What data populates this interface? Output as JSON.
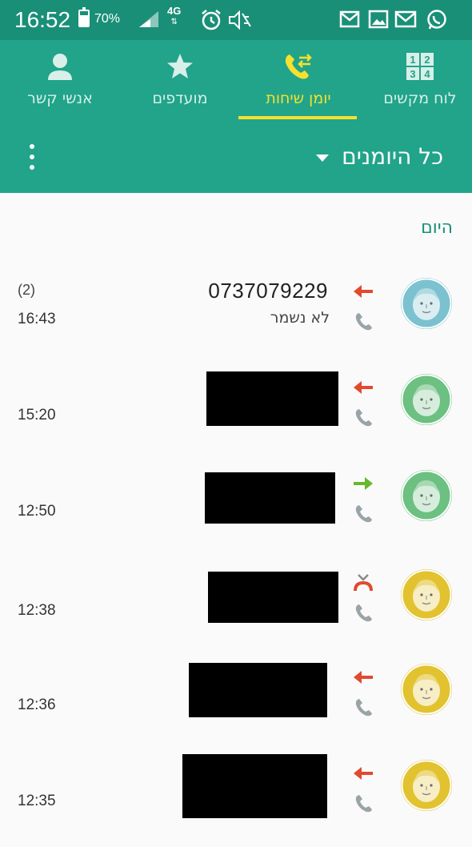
{
  "status_bar": {
    "time": "16:52",
    "battery_percent": "70%",
    "battery_level": 0.7,
    "network": "4G",
    "icons": [
      "battery-icon",
      "signal-icon",
      "alarm-icon",
      "mute-icon",
      "gmail-icon",
      "gallery-icon",
      "gmail-icon",
      "whatsapp-icon"
    ]
  },
  "tabs": [
    {
      "label": "לוח מקשים",
      "icon": "dialpad-icon"
    },
    {
      "label": "יומן שיחות",
      "icon": "call-log-icon",
      "active": true
    },
    {
      "label": "מועדפים",
      "icon": "star-icon"
    },
    {
      "label": "אנשי קשר",
      "icon": "contacts-icon"
    }
  ],
  "toolbar": {
    "filter_label": "כל היומנים",
    "menu_icon": "overflow-menu-icon"
  },
  "section": {
    "today_label": "היום"
  },
  "calls": [
    {
      "number": "0737079229",
      "sub": "לא נשמר",
      "count": "(2)",
      "time": "16:43",
      "direction": "incoming",
      "avatar_color": "#7cc1cf"
    },
    {
      "number": "",
      "sub": "",
      "count": "",
      "time": "15:20",
      "direction": "incoming",
      "avatar_color": "#6cc081"
    },
    {
      "number": "",
      "sub": "",
      "count": "",
      "time": "12:50",
      "direction": "outgoing",
      "avatar_color": "#6cc081"
    },
    {
      "number": "",
      "sub": "",
      "count": "",
      "time": "12:38",
      "direction": "rejected",
      "avatar_color": "#e2c22f"
    },
    {
      "number": "",
      "sub": "",
      "count": "",
      "time": "12:36",
      "direction": "incoming",
      "avatar_color": "#e2c22f"
    },
    {
      "number": "",
      "sub": "",
      "count": "",
      "time": "12:35",
      "direction": "incoming",
      "avatar_color": "#e2c22f"
    }
  ],
  "colors": {
    "status_bar": "#1a8f78",
    "header": "#21a48a",
    "active_tab": "#f5e12e",
    "incoming_arrow": "#e04a2e",
    "outgoing_arrow": "#66b82d"
  }
}
